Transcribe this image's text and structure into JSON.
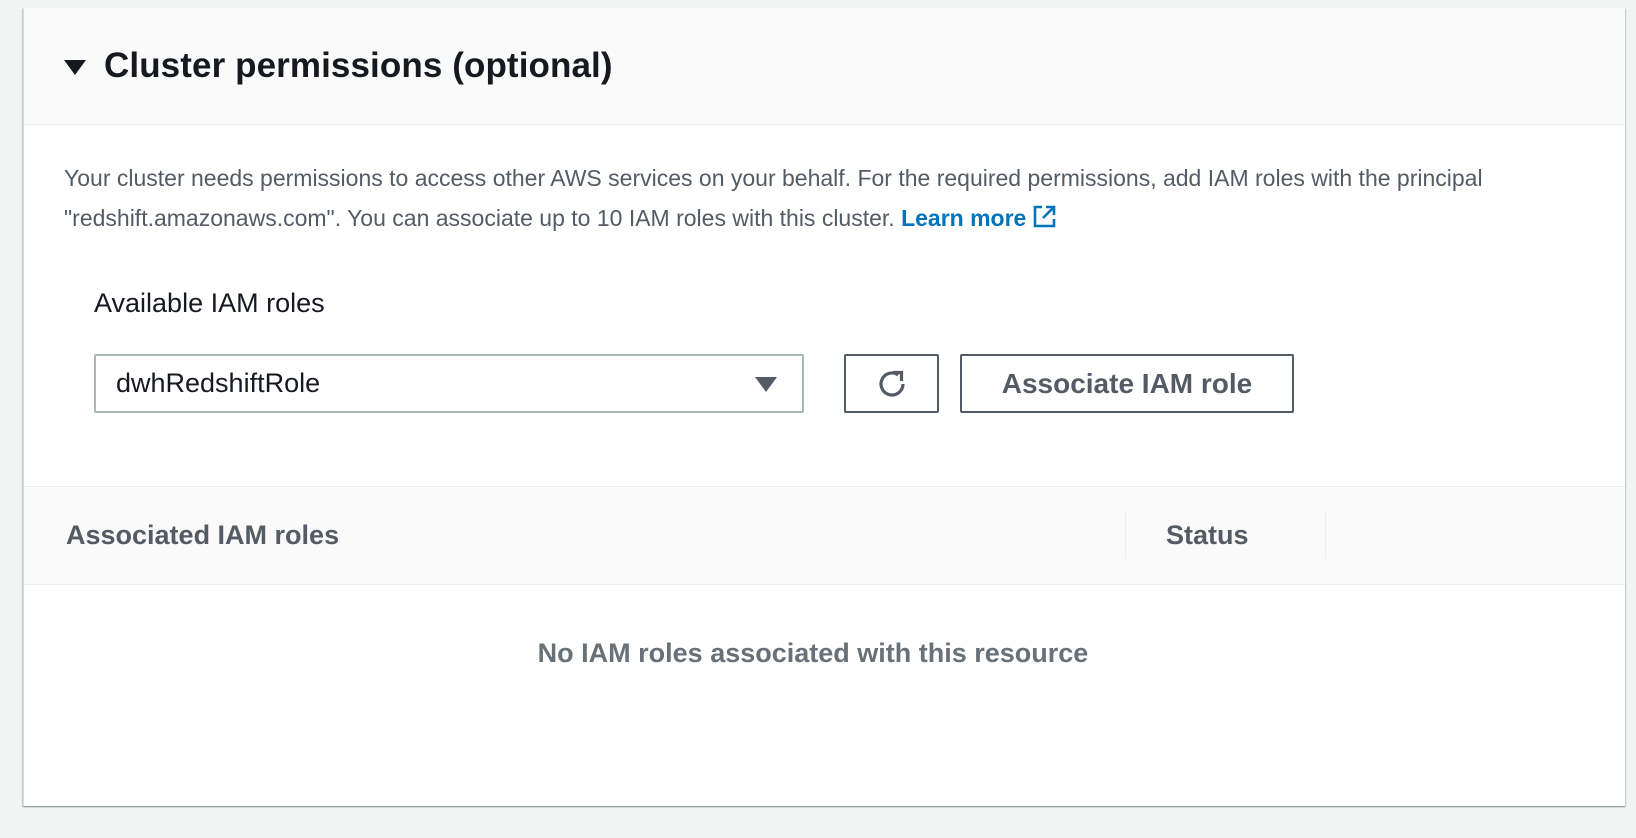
{
  "panel": {
    "title": "Cluster permissions (optional)",
    "description_text": "Your cluster needs permissions to access other AWS services on your behalf. For the required permissions, add IAM roles with the principal \"redshift.amazonaws.com\". You can associate up to 10 IAM roles with this cluster.",
    "learn_more_label": "Learn more"
  },
  "iam_roles": {
    "label": "Available IAM roles",
    "selected_value": "dwhRedshiftRole",
    "associate_button_label": "Associate IAM role"
  },
  "table": {
    "columns": [
      "Associated IAM roles",
      "Status"
    ],
    "empty_message": "No IAM roles associated with this resource"
  },
  "colors": {
    "link": "#0073bb",
    "text_primary": "#16191f",
    "text_secondary": "#545b64",
    "empty_text": "#687078",
    "header_bg": "#fafafa",
    "page_bg": "#f2f3f3"
  },
  "icons": [
    "caret-down-icon",
    "external-link-icon",
    "dropdown-caret-icon",
    "refresh-icon"
  ]
}
